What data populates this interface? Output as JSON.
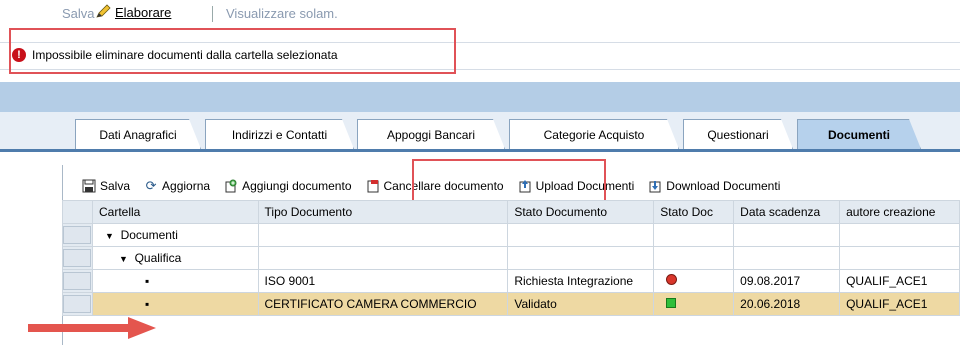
{
  "toolbar_top": {
    "save": "Salva",
    "edit": "Elaborare",
    "view": "Visualizzare solam."
  },
  "message": {
    "text": "Impossibile eliminare documenti dalla cartella selezionata",
    "type": "error"
  },
  "tabs": [
    {
      "label": "Dati Anagrafici",
      "active": false
    },
    {
      "label": "Indirizzi e Contatti",
      "active": false
    },
    {
      "label": "Appoggi Bancari",
      "active": false
    },
    {
      "label": "Categorie Acquisto",
      "active": false
    },
    {
      "label": "Questionari",
      "active": false
    },
    {
      "label": "Documenti",
      "active": true
    }
  ],
  "doc_toolbar": {
    "save": "Salva",
    "refresh": "Aggiorna",
    "add": "Aggiungi documento",
    "delete": "Cancellare documento",
    "upload": "Upload Documenti",
    "download": "Download Documenti"
  },
  "table": {
    "columns": [
      "Cartella",
      "Tipo Documento",
      "Stato Documento",
      "Stato Doc",
      "Data scadenza",
      "autore creazione"
    ],
    "rows": [
      {
        "folder": "Documenti",
        "type": "",
        "state": "",
        "status_icon": "",
        "date": "",
        "author": ""
      },
      {
        "folder": "Qualifica",
        "type": "",
        "state": "",
        "status_icon": "",
        "date": "",
        "author": ""
      },
      {
        "folder": "",
        "type": "ISO 9001",
        "state": "Richiesta Integrazione",
        "status_icon": "red-status-icon",
        "date": "09.08.2017",
        "author": "QUALIF_ACE1"
      },
      {
        "folder": "",
        "type": "CERTIFICATO CAMERA COMMERCIO",
        "state": "Validato",
        "status_icon": "green-status-icon",
        "date": "20.06.2018",
        "author": "QUALIF_ACE1"
      }
    ]
  },
  "colors": {
    "highlight_row": "#eed9a3",
    "annotation_red": "#e05257",
    "tab_active": "#b6d1ec",
    "header_band": "#b4cde6"
  }
}
